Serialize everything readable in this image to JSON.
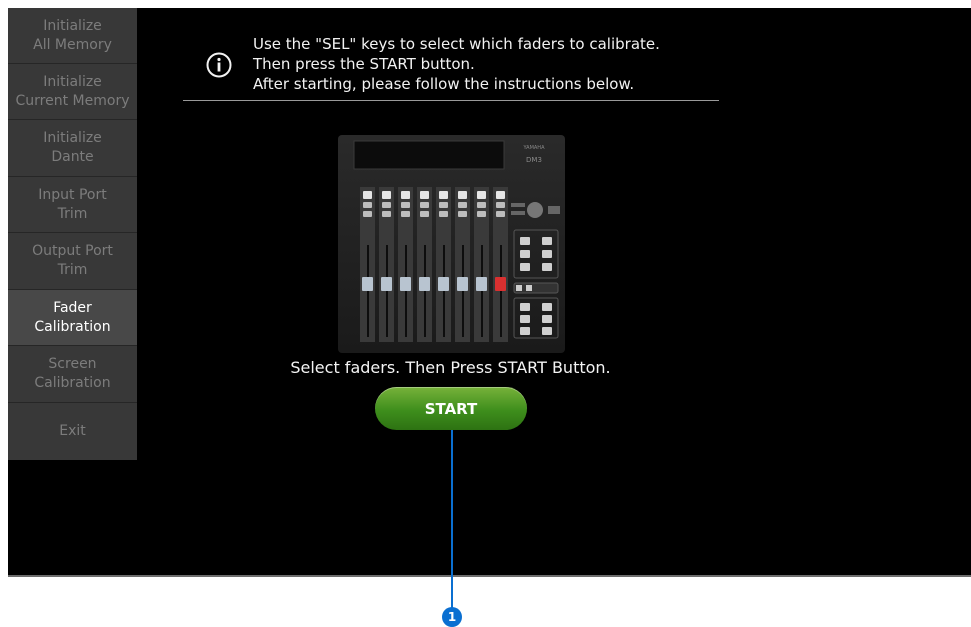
{
  "sidebar": {
    "items": [
      {
        "label": "Initialize\nAll Memory",
        "active": false
      },
      {
        "label": "Initialize\nCurrent Memory",
        "active": false
      },
      {
        "label": "Initialize\nDante",
        "active": false
      },
      {
        "label": "Input Port\nTrim",
        "active": false
      },
      {
        "label": "Output Port\nTrim",
        "active": false
      },
      {
        "label": "Fader\nCalibration",
        "active": true
      },
      {
        "label": "Screen\nCalibration",
        "active": false
      },
      {
        "label": "Exit",
        "active": false
      }
    ]
  },
  "instructions": {
    "icon": "info-icon",
    "line1": "Use the \"SEL\" keys to select which faders to calibrate.",
    "line2": "Then press the START button.",
    "line3": "After starting, please follow the instructions below."
  },
  "console": {
    "brand": "YAMAHA",
    "model": "DM3"
  },
  "status_text": "Select faders. Then Press START Button.",
  "start_button": {
    "label": "START",
    "color": "#3e8e1c"
  },
  "callout": {
    "number": "1",
    "color": "#0a6fd1"
  }
}
